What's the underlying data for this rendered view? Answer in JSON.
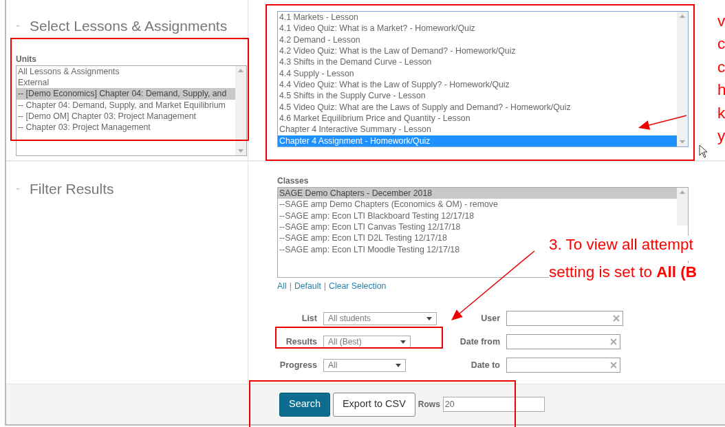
{
  "sections": [
    {
      "toggle": "-",
      "title": "Select Lessons & Assignments"
    },
    {
      "toggle": "-",
      "title": "Filter Results"
    }
  ],
  "units": {
    "label": "Units",
    "items": [
      {
        "text": "All Lessons & Assignments",
        "selected": false
      },
      {
        "text": "External",
        "selected": false
      },
      {
        "text": "-- [Demo Economics] Chapter 04: Demand, Supply, and",
        "selected": true
      },
      {
        "text": "-- Chapter 04: Demand, Supply, and Market Equilibrium",
        "selected": false
      },
      {
        "text": "-- [Demo OM] Chapter 03: Project Management",
        "selected": false
      },
      {
        "text": "-- Chapter 03: Project Management",
        "selected": false
      }
    ]
  },
  "lessons": {
    "items": [
      {
        "text": "4.1 Markets - Lesson",
        "selected": false
      },
      {
        "text": "4.1 Video Quiz: What is a Market? - Homework/Quiz",
        "selected": false
      },
      {
        "text": "4.2 Demand - Lesson",
        "selected": false
      },
      {
        "text": "4.2 Video Quiz: What is the Law of Demand? - Homework/Quiz",
        "selected": false
      },
      {
        "text": "4.3 Shifts in the Demand Curve - Lesson",
        "selected": false
      },
      {
        "text": "4.4 Supply - Lesson",
        "selected": false
      },
      {
        "text": "4.4 Video Quiz: What is the Law of Supply? - Homework/Quiz",
        "selected": false
      },
      {
        "text": "4.5 Shifts in the Supply Curve - Lesson",
        "selected": false
      },
      {
        "text": "4.5 Video Quiz: What are the Laws of Supply and Demand? - Homework/Quiz",
        "selected": false
      },
      {
        "text": "4.6 Market Equilibrium Price and Quantity - Lesson",
        "selected": false
      },
      {
        "text": "Chapter 4 Interactive Summary - Lesson",
        "selected": false
      },
      {
        "text": "Chapter 4 Assignment - Homework/Quiz",
        "selected": true
      }
    ]
  },
  "classes": {
    "label": "Classes",
    "items": [
      {
        "text": "SAGE Demo Chapters - December 2018",
        "selected": true
      },
      {
        "text": "--SAGE amp Demo Chapters (Economics & OM) - remove",
        "selected": false
      },
      {
        "text": "--SAGE amp: Econ LTI Blackboard Testing 12/17/18",
        "selected": false
      },
      {
        "text": "--SAGE amp: Econ LTI Canvas Testing 12/17/18",
        "selected": false
      },
      {
        "text": "--SAGE amp: Econ LTI D2L Testing 12/17/18",
        "selected": false
      },
      {
        "text": "--SAGE amp: Econ LTI Moodle Testing 12/17/18",
        "selected": false
      }
    ],
    "links": [
      "All",
      "Default",
      "Clear Selection"
    ],
    "link_separator": "|"
  },
  "filters": [
    {
      "label": "List",
      "kind": "select",
      "value": "All students"
    },
    {
      "label": "User",
      "kind": "clearable"
    },
    {
      "label": "Results",
      "kind": "select",
      "value": "All (Best)"
    },
    {
      "label": "Date from",
      "kind": "clearable"
    },
    {
      "label": "Progress",
      "kind": "select",
      "value": "All"
    },
    {
      "label": "Date to",
      "kind": "clearable"
    }
  ],
  "footer": {
    "buttons": [
      {
        "label": "Search",
        "kind": "primary"
      },
      {
        "label": "Export to CSV",
        "kind": "secondary"
      }
    ],
    "rows_label": "Rows",
    "rows_value": "20"
  },
  "annotations": {
    "side_letters": [
      "v",
      "c",
      "c",
      "h",
      "k",
      "y"
    ],
    "step_lines": [
      "3. To view all attempt",
      "setting is set to **All (B**"
    ]
  }
}
